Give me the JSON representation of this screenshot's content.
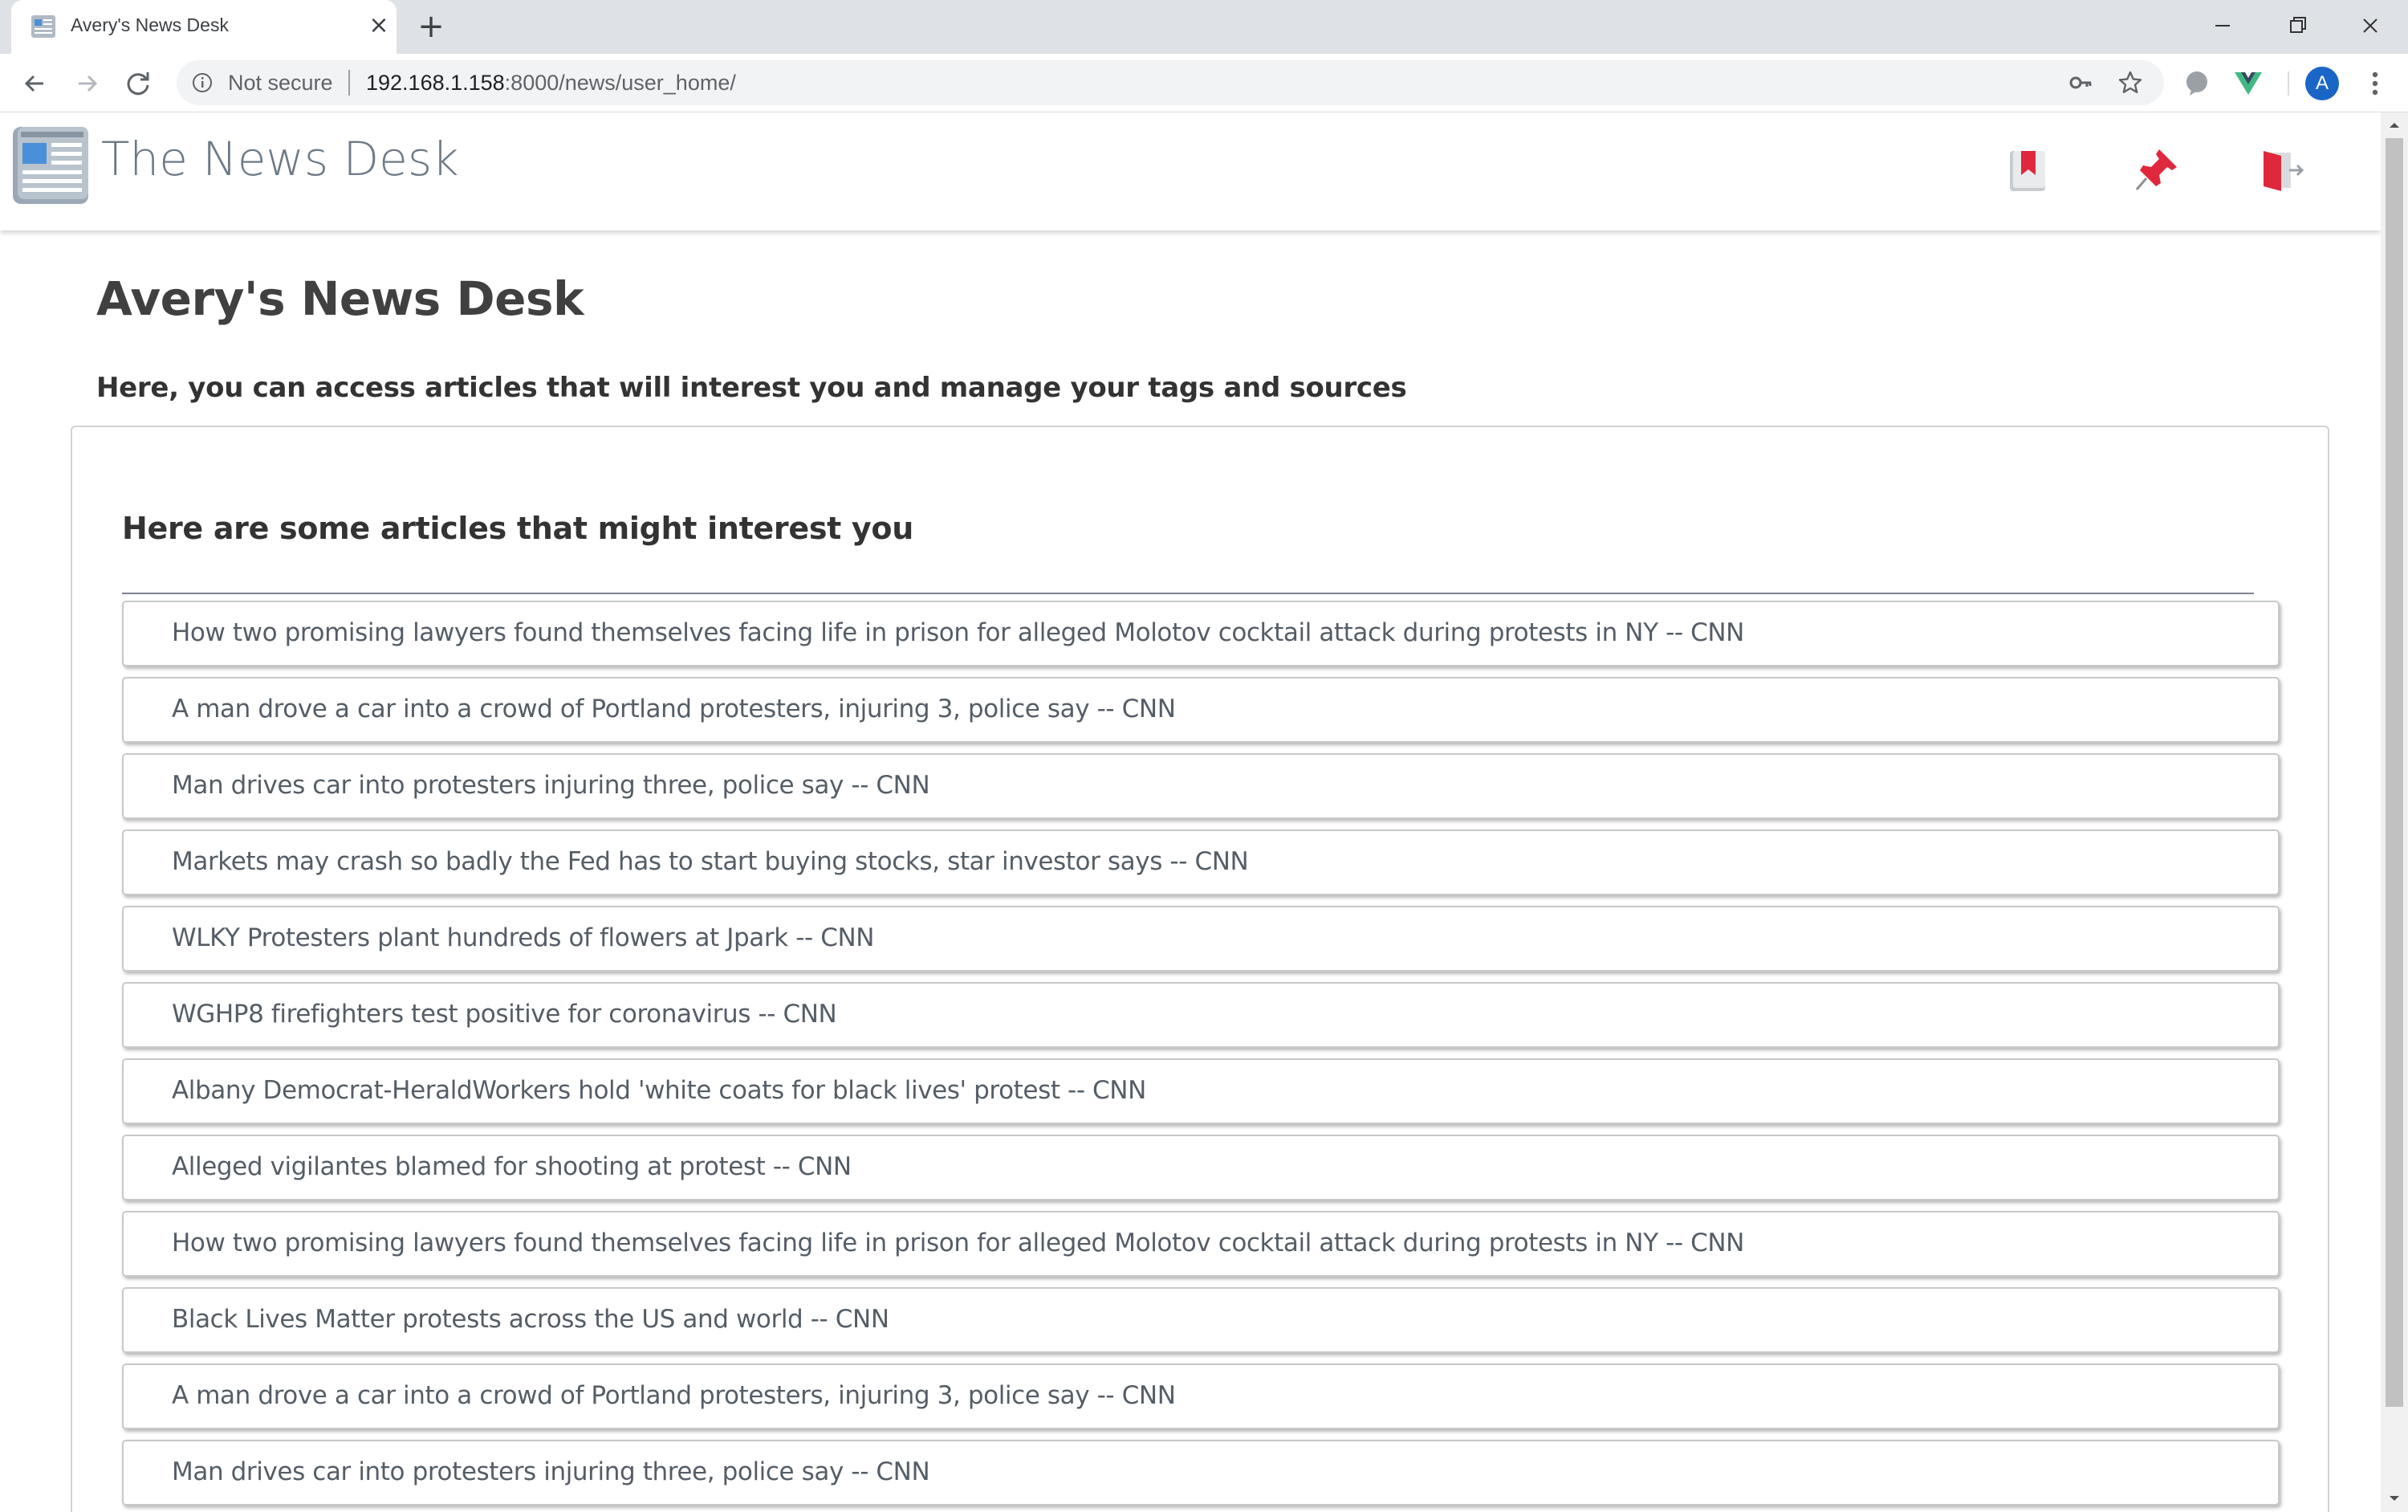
{
  "browser": {
    "tab_title": "Avery's News Desk",
    "security_label": "Not secure",
    "url_host": "192.168.1.158",
    "url_path": ":8000/news/user_home/",
    "profile_initial": "A"
  },
  "site": {
    "name": "The News Desk",
    "icons": [
      "bookmark-icon",
      "pin-icon",
      "logout-icon"
    ]
  },
  "page": {
    "title": "Avery's News Desk",
    "subtitle": "Here, you can access articles that will interest you and manage your tags and sources"
  },
  "articles_section": {
    "heading": "Here are some articles that might interest you",
    "items": [
      {
        "label": "How two promising lawyers found themselves facing life in prison for alleged Molotov cocktail attack during protests in NY -- CNN"
      },
      {
        "label": "A man drove a car into a crowd of Portland protesters, injuring 3, police say -- CNN"
      },
      {
        "label": "Man drives car into protesters injuring three, police say -- CNN"
      },
      {
        "label": "Markets may crash so badly the Fed has to start buying stocks, star investor says -- CNN"
      },
      {
        "label": "WLKY Protesters plant hundreds of flowers at Jpark -- CNN"
      },
      {
        "label": "WGHP8 firefighters test positive for coronavirus -- CNN"
      },
      {
        "label": "Albany Democrat-HeraldWorkers hold 'white coats for black lives' protest -- CNN"
      },
      {
        "label": "Alleged vigilantes blamed for shooting at protest -- CNN"
      },
      {
        "label": "How two promising lawyers found themselves facing life in prison for alleged Molotov cocktail attack during protests in NY -- CNN"
      },
      {
        "label": "Black Lives Matter protests across the US and world -- CNN"
      },
      {
        "label": "A man drove a car into a crowd of Portland protesters, injuring 3, police say -- CNN"
      },
      {
        "label": "Man drives car into protesters injuring three, police say -- CNN"
      }
    ]
  },
  "colors": {
    "accent_red": "#e0283c",
    "logo_blue": "#4a90d9",
    "text_muted": "#555d66"
  }
}
